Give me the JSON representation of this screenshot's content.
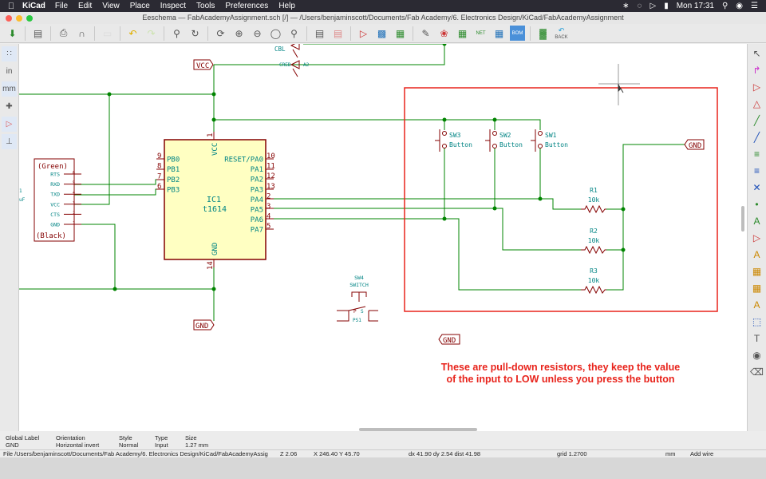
{
  "menubar": {
    "app": "KiCad",
    "items": [
      "File",
      "Edit",
      "View",
      "Place",
      "Inspect",
      "Tools",
      "Preferences",
      "Help"
    ],
    "clock": "Mon 17:31"
  },
  "window": {
    "title": "Eeschema — FabAcademyAssignment.sch [/] — /Users/benjaminscott/Documents/Fab Academy/6. Electronics Design/KiCad/FabAcademyAssignment"
  },
  "toolbar": {
    "back_label": "BACK",
    "net_label": "NET",
    "bom_label": "BOM"
  },
  "left_toolbar": {
    "inch_label": "in",
    "mm_label": "mm"
  },
  "schematic": {
    "vcc_label": "VCC",
    "gnd_label": "GND",
    "ic": {
      "ref": "IC1",
      "value": "t1614",
      "vcc_pin": "VCC",
      "gnd_pin": "GND",
      "vcc_num": "1",
      "gnd_num": "14",
      "left_pins": [
        {
          "num": "9",
          "name": "PB0"
        },
        {
          "num": "8",
          "name": "PB1"
        },
        {
          "num": "7",
          "name": "PB2"
        },
        {
          "num": "6",
          "name": "PB3"
        }
      ],
      "right_pins": [
        {
          "num": "10",
          "name": "RESET/PA0"
        },
        {
          "num": "11",
          "name": "PA1"
        },
        {
          "num": "12",
          "name": "PA2"
        },
        {
          "num": "13",
          "name": "PA3"
        },
        {
          "num": "2",
          "name": "PA4"
        },
        {
          "num": "3",
          "name": "PA5"
        },
        {
          "num": "4",
          "name": "PA6"
        },
        {
          "num": "5",
          "name": "PA7"
        }
      ]
    },
    "connector": {
      "top": "(Green)",
      "bottom": "(Black)",
      "pins": [
        {
          "num": "6",
          "name": "RTS"
        },
        {
          "num": "5",
          "name": "RXD"
        },
        {
          "num": "4",
          "name": "TXD"
        },
        {
          "num": "3",
          "name": "VCC"
        },
        {
          "num": "2",
          "name": "CTS"
        },
        {
          "num": "1",
          "name": "GND"
        }
      ]
    },
    "led": {
      "cathode": "CBL",
      "cathode2": "CRED",
      "anode": "A2"
    },
    "switches": [
      {
        "ref": "SW3",
        "value": "Button"
      },
      {
        "ref": "SW2",
        "value": "Button"
      },
      {
        "ref": "SW1",
        "value": "Button"
      }
    ],
    "resistors": [
      {
        "ref": "R1",
        "value": "10k"
      },
      {
        "ref": "R2",
        "value": "10k"
      },
      {
        "ref": "R3",
        "value": "10k"
      }
    ],
    "sw4": {
      "ref": "SW4",
      "value": "SWITCH",
      "pin_p": "P",
      "pin_s": "S",
      "pin_label": "PS1"
    },
    "left_partial": [
      "1",
      "uF"
    ],
    "note_line1": "These are pull-down resistors, they keep the value",
    "note_line2": "of the input to LOW unless you press the button",
    "colors": {
      "wire": "#008400",
      "junction": "#008400",
      "component": "#840000",
      "ic_fill": "#ffffc2",
      "text": "#008484",
      "annotation": "#e8231b"
    }
  },
  "message_panel": {
    "columns": [
      {
        "h": "Global Label",
        "v": "GND"
      },
      {
        "h": "Orientation",
        "v": "Horizontal invert"
      },
      {
        "h": "Style",
        "v": "Normal"
      },
      {
        "h": "Type",
        "v": "Input"
      },
      {
        "h": "Size",
        "v": "1.27 mm"
      }
    ]
  },
  "status": {
    "file": "File /Users/benjaminscott/Documents/Fab Academy/6. Electronics Design/KiCad/FabAcademyAssig",
    "zoom": "Z 2.06",
    "xy": "X 246.40  Y 45.70",
    "delta": "dx 41.90  dy 2.54  dist 41.98",
    "grid": "grid 1.2700",
    "units": "mm",
    "mode": "Add wire"
  }
}
